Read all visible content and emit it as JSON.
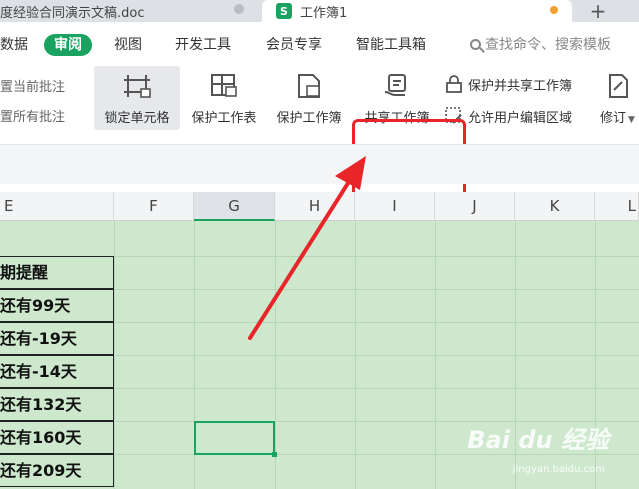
{
  "tabs": {
    "doc_title": "度经验合同演示文稿.doc",
    "sheet_icon": "S",
    "sheet_title": "工作簿1",
    "new_tab": "+"
  },
  "menu": {
    "items": [
      "数据",
      "审阅",
      "视图",
      "开发工具",
      "会员专享",
      "智能工具箱"
    ],
    "active": "审阅",
    "search_label": "查找命令、搜索模板"
  },
  "ribbon": {
    "reset_current_comment": "置当前批注",
    "reset_all_comments": "置所有批注",
    "lock_cell": "锁定单元格",
    "protect_sheet": "保护工作表",
    "protect_workbook": "保护工作簿",
    "share_workbook": "共享工作簿",
    "protect_and_share": "保护并共享工作簿",
    "allow_edit_ranges": "允许用户编辑区域",
    "track_changes": "修订"
  },
  "sheet": {
    "columns": [
      "E",
      "F",
      "G",
      "H",
      "I",
      "J",
      "K",
      "L"
    ],
    "selected_column": "G",
    "e_column_cells": [
      "期提醒",
      "还有99天",
      "还有-19天",
      "还有-14天",
      "还有132天",
      "还有160天",
      "还有209天"
    ]
  },
  "watermark": {
    "brand": "Bai du 经验",
    "url": "jingyan.baidu.com"
  },
  "colors": {
    "accent": "#1aa260",
    "highlight": "#e8262a",
    "grid_fill": "#cde8cd"
  }
}
